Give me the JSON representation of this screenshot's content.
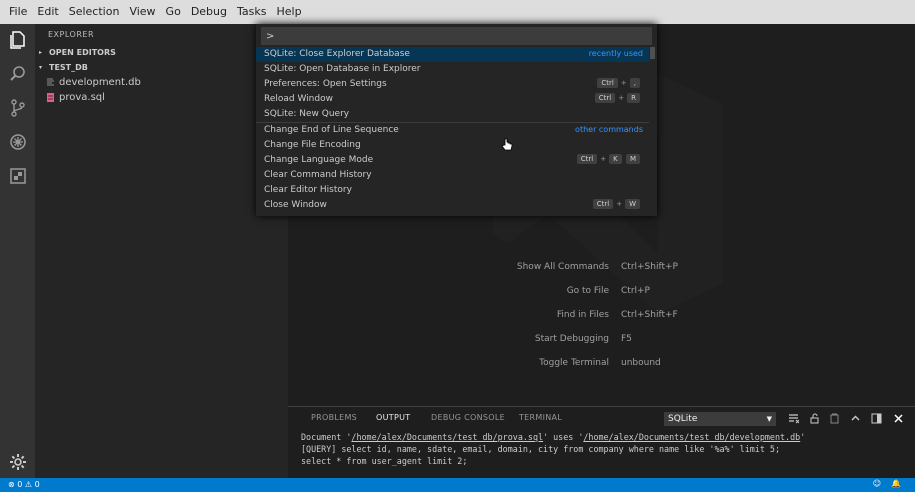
{
  "menubar": {
    "items": [
      "File",
      "Edit",
      "Selection",
      "View",
      "Go",
      "Debug",
      "Tasks",
      "Help"
    ]
  },
  "activitybar": {
    "icons": [
      "files-icon",
      "search-icon",
      "source-control-icon",
      "debug-icon",
      "extensions-icon",
      "gear-icon"
    ]
  },
  "sidebar": {
    "title": "EXPLORER",
    "open_editors": "OPEN EDITORS",
    "folder": "TEST_DB",
    "files": [
      {
        "name": "development.db",
        "icon": "file-lines-icon",
        "color": "#8a8a8a"
      },
      {
        "name": "prova.sql",
        "icon": "database-file-icon",
        "color": "#e05e8a"
      }
    ]
  },
  "palette": {
    "input_value": ">",
    "items": [
      {
        "label": "SQLite: Close Explorer Database",
        "note": "recently used",
        "keys": []
      },
      {
        "label": "SQLite: Open Database in Explorer",
        "note": "",
        "keys": []
      },
      {
        "label": "Preferences: Open Settings",
        "note": "",
        "keys": [
          "Ctrl",
          ","
        ]
      },
      {
        "label": "Reload Window",
        "note": "",
        "keys": [
          "Ctrl",
          "R"
        ]
      },
      {
        "label": "SQLite: New Query",
        "note": "",
        "keys": []
      },
      {
        "label": "Change End of Line Sequence",
        "note": "other commands",
        "keys": []
      },
      {
        "label": "Change File Encoding",
        "note": "",
        "keys": []
      },
      {
        "label": "Change Language Mode",
        "note": "",
        "keys": [
          "Ctrl",
          "K",
          "M"
        ]
      },
      {
        "label": "Clear Command History",
        "note": "",
        "keys": []
      },
      {
        "label": "Clear Editor History",
        "note": "",
        "keys": []
      },
      {
        "label": "Close Window",
        "note": "",
        "keys": [
          "Ctrl",
          "W"
        ]
      }
    ]
  },
  "shortcuts": [
    {
      "label": "Show All Commands",
      "key": "Ctrl+Shift+P"
    },
    {
      "label": "Go to File",
      "key": "Ctrl+P"
    },
    {
      "label": "Find in Files",
      "key": "Ctrl+Shift+F"
    },
    {
      "label": "Start Debugging",
      "key": "F5"
    },
    {
      "label": "Toggle Terminal",
      "key": "unbound"
    }
  ],
  "panel": {
    "tabs": [
      "PROBLEMS",
      "OUTPUT",
      "DEBUG CONSOLE",
      "TERMINAL"
    ],
    "active_tab": "OUTPUT",
    "channel": "SQLite",
    "output": {
      "line1_prefix": "Document '",
      "line1_path1": "/home/alex/Documents/test_db/prova.sql",
      "line1_mid": "' uses '",
      "line1_path2": "/home/alex/Documents/test_db/development.db",
      "line1_suffix": "'",
      "line2": "[QUERY] select id, name, sdate, email, domain, city from company where name like '%a%' limit 5;",
      "line3": "select * from user_agent limit 2;"
    }
  },
  "statusbar": {
    "errors": "0",
    "warnings": "0",
    "color": "#007acc"
  }
}
